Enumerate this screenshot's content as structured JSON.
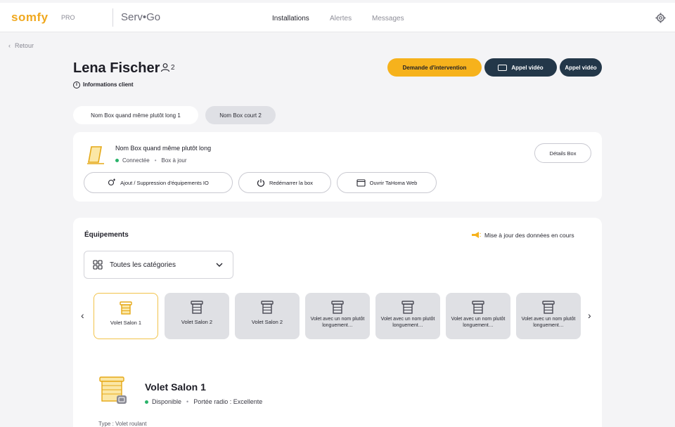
{
  "brand": {
    "logo": "somfy",
    "pro": "PRO",
    "app": "Serv•Go"
  },
  "nav": {
    "items": [
      "Installations",
      "Alertes",
      "Messages"
    ]
  },
  "back": {
    "label": "Retour"
  },
  "client": {
    "name": "Lena Fischer",
    "count": "2",
    "info_label": "Informations client"
  },
  "actions": {
    "intervention": "Demande d'intervention",
    "video_call": "Appel vidéo",
    "video_call_short": "Appel vidéo"
  },
  "box_tabs": [
    "Nom Box quand même plutôt long 1",
    "Nom Box court 2"
  ],
  "box": {
    "title": "Nom Box quand même plutôt long",
    "status": "Connectée",
    "update": "Box à jour",
    "details": "Détails Box",
    "buttons": [
      "Ajout / Suppression d'équipements IO",
      "Redémarrer la box",
      "Ouvrir TaHoma Web"
    ]
  },
  "equipment": {
    "title": "Équipements",
    "update_note": "Mise à jour des données en cours",
    "category": "Toutes les catégories",
    "tiles": [
      "Volet Salon 1",
      "Volet Salon 2",
      "Volet Salon 2",
      "Volet avec un nom plutôt longuement…",
      "Volet avec un nom plutôt longuement…",
      "Volet avec un nom plutôt longuement…",
      "Volet avec un nom plutôt longuement…"
    ],
    "selected": {
      "name": "Volet Salon 1",
      "status": "Disponible",
      "radio": "Portée radio : Excellente",
      "type": "Type : Volet roulant"
    }
  },
  "colors": {
    "accent": "#f6b21c",
    "dark_button": "#233749",
    "status_ok": "#2ab36a",
    "brand": "#f0a81e"
  }
}
